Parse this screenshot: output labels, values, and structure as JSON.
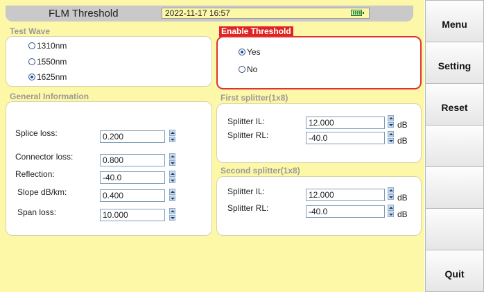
{
  "header": {
    "title": "FLM Threshold",
    "datetime": "2022-11-17 16:57"
  },
  "test_wave": {
    "label": "Test Wave",
    "options": [
      "1310nm",
      "1550nm",
      "1625nm"
    ],
    "selected": "1625nm"
  },
  "enable_threshold": {
    "label": "Enable Threshold",
    "options": [
      "Yes",
      "No"
    ],
    "selected": "Yes"
  },
  "general": {
    "label": "General Information",
    "rows": [
      {
        "label": "Splice loss:",
        "value": "0.200"
      },
      {
        "label": "Connector loss:",
        "value": "0.800"
      },
      {
        "label": "Reflection:",
        "value": "-40.0"
      },
      {
        "label": "Slope dB/km:",
        "value": "0.400"
      },
      {
        "label": "Span loss:",
        "value": "10.000"
      }
    ]
  },
  "first_splitter": {
    "label": "First splitter(1x8)",
    "rows": [
      {
        "label": "Splitter IL:",
        "value": "12.000",
        "unit": "dB"
      },
      {
        "label": "Splitter RL:",
        "value": "-40.0",
        "unit": "dB"
      }
    ]
  },
  "second_splitter": {
    "label": "Second splitter(1x8)",
    "rows": [
      {
        "label": "Splitter IL:",
        "value": "12.000",
        "unit": "dB"
      },
      {
        "label": "Splitter RL:",
        "value": "-40.0",
        "unit": "dB"
      }
    ]
  },
  "menu": {
    "items": [
      "Menu",
      "Setting",
      "Reset",
      "",
      "",
      "",
      "Quit"
    ]
  },
  "colors": {
    "background": "#fdf7a8",
    "enable_label_bg": "#e02424",
    "section_label": "#9a9a9a"
  },
  "icons": {
    "battery": "battery-icon",
    "spin": "spin-arrows-icon"
  }
}
